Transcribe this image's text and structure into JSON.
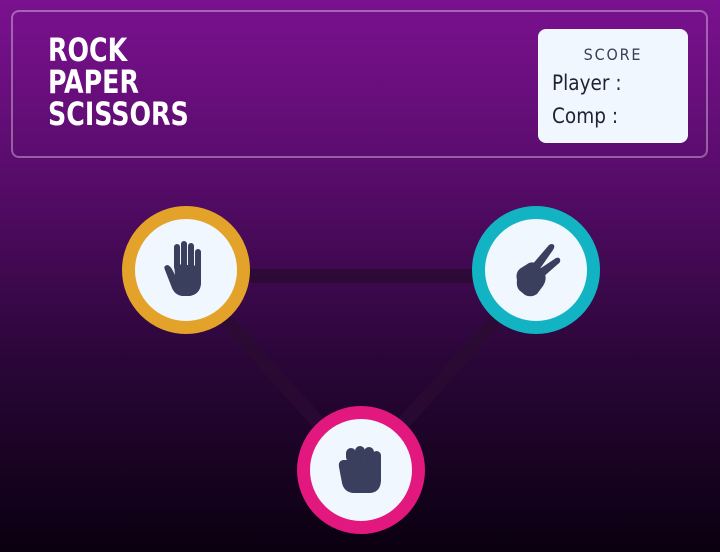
{
  "game": {
    "title_lines": [
      "ROCK",
      "PAPER",
      "SCISSORS"
    ]
  },
  "score": {
    "heading": "SCORE",
    "player_label": "Player :",
    "comp_label": "Comp :"
  },
  "choices": [
    {
      "id": "paper",
      "icon": "hand-paper-icon",
      "ring_color": "#e3a22a"
    },
    {
      "id": "scissors",
      "icon": "hand-scissors-icon",
      "ring_color": "#12b4c4"
    },
    {
      "id": "rock",
      "icon": "hand-rock-icon",
      "ring_color": "#e2187f"
    }
  ],
  "colors": {
    "icon": "#3a3f5e",
    "card_bg": "#f0f7ff",
    "triangle": "#2a0a32"
  }
}
